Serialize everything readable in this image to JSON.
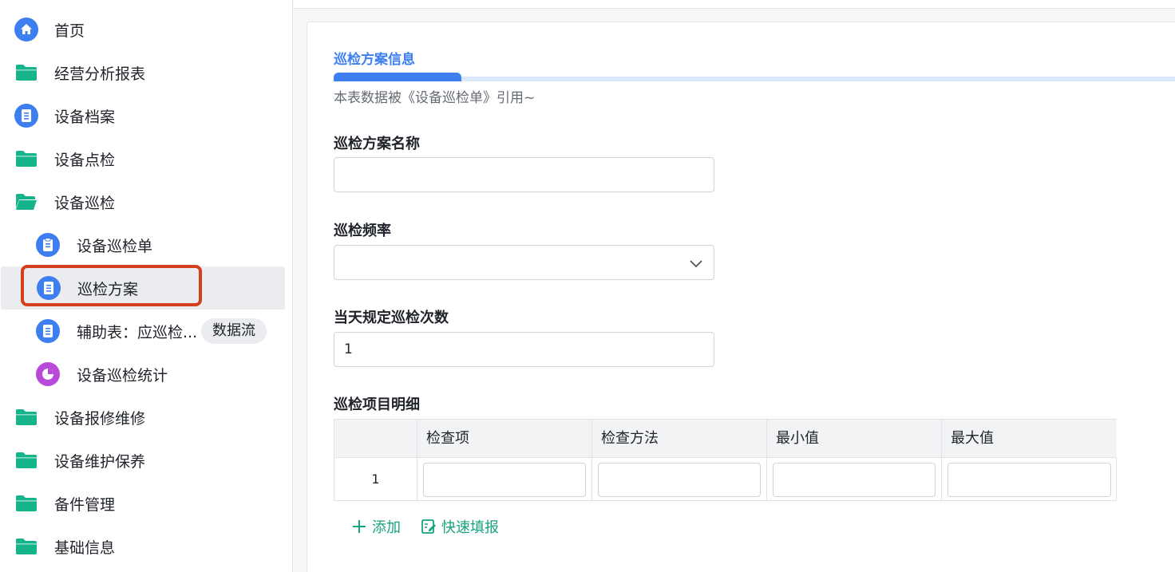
{
  "sidebar": {
    "items": [
      {
        "label": "首页",
        "icon": "home-icon"
      },
      {
        "label": "经营分析报表",
        "icon": "folder-icon"
      },
      {
        "label": "设备档案",
        "icon": "form-icon"
      },
      {
        "label": "设备点检",
        "icon": "folder-icon"
      },
      {
        "label": "设备巡检",
        "icon": "folder-open-icon"
      },
      {
        "label": "设备巡检单",
        "icon": "clipboard-icon"
      },
      {
        "label": "巡检方案",
        "icon": "form-icon"
      },
      {
        "label": "辅助表：应巡检...",
        "icon": "form-icon",
        "tag": "数据流"
      },
      {
        "label": "设备巡检统计",
        "icon": "pie-chart-icon"
      },
      {
        "label": "设备报修维修",
        "icon": "folder-icon"
      },
      {
        "label": "设备维护保养",
        "icon": "folder-icon"
      },
      {
        "label": "备件管理",
        "icon": "folder-icon"
      },
      {
        "label": "基础信息",
        "icon": "folder-icon"
      }
    ],
    "active_item": "巡检方案"
  },
  "form": {
    "section_title": "巡检方案信息",
    "ref_note": "本表数据被《设备巡检单》引用~",
    "fields": {
      "plan_name": {
        "label": "巡检方案名称",
        "value": ""
      },
      "frequency": {
        "label": "巡检频率",
        "value": ""
      },
      "daily_count": {
        "label": "当天规定巡检次数",
        "value": "1"
      }
    },
    "detail": {
      "label": "巡检项目明细",
      "columns": [
        "检查项",
        "检查方法",
        "最小值",
        "最大值"
      ],
      "rows": [
        {
          "index": "1",
          "values": [
            "",
            "",
            "",
            ""
          ]
        }
      ]
    },
    "actions": {
      "add": "添加",
      "quick_fill": "快速填报"
    }
  },
  "colors": {
    "accent": "#3d7ef0",
    "folder": "#16b48a",
    "action": "#16a37f",
    "highlight": "#d2401d"
  }
}
